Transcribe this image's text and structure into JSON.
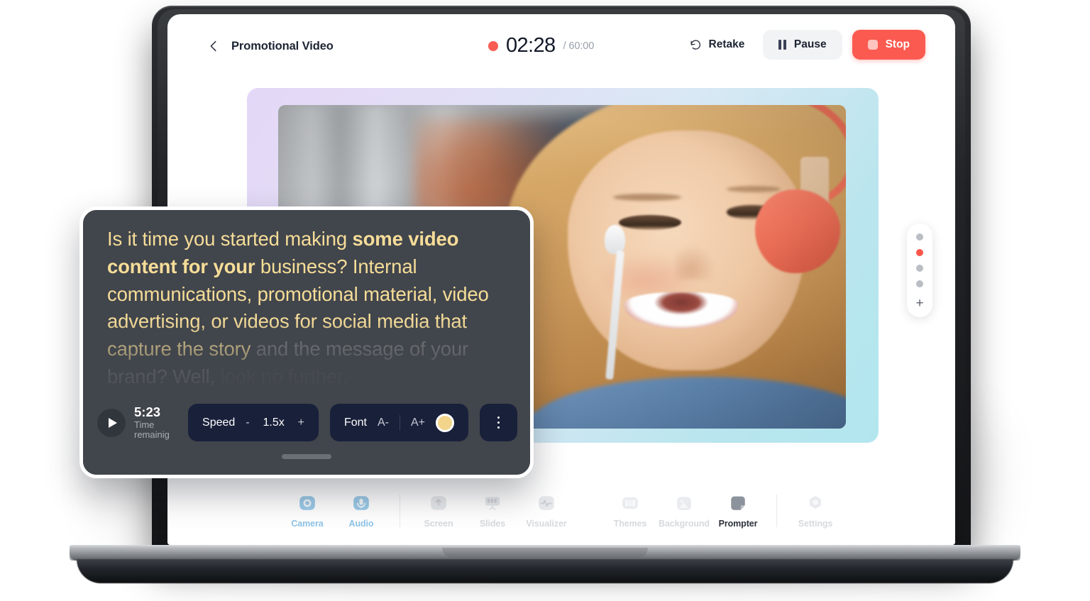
{
  "header": {
    "back_icon": "chevron-left-icon",
    "project_title": "Promotional Video",
    "record_dot": "record-dot-icon",
    "elapsed_time": "02:28",
    "total_time": "/ 60:00",
    "retake_label": "Retake",
    "retake_icon": "rotate-ccw-icon",
    "pause_label": "Pause",
    "pause_icon": "pause-icon",
    "stop_label": "Stop",
    "stop_icon": "stop-square-icon"
  },
  "colors": {
    "accent_red": "#fb5a50",
    "record_dot": "#fa5c52",
    "prompter_bg": "#41454c",
    "prompter_text": "#f6dd98",
    "control_bg": "#19203a",
    "swatch": "#f2d58a",
    "active_tool": "#8ec4e8",
    "frame_gradient_start": "#e4d7f7",
    "frame_gradient_end": "#b2e6ef"
  },
  "video": {
    "frame_label": "video-preview-frame"
  },
  "dot_rail": {
    "dots": [
      {
        "name": "scene-dot-1",
        "active": false
      },
      {
        "name": "scene-dot-2",
        "active": true
      },
      {
        "name": "scene-dot-3",
        "active": false
      },
      {
        "name": "scene-dot-4",
        "active": false
      }
    ],
    "add_label": "+"
  },
  "prompter": {
    "script_lines": [
      {
        "text": "Is it time you started making ",
        "style": "normal",
        "state": "read"
      },
      {
        "text": "some video content for your",
        "style": "bold",
        "state": "read"
      },
      {
        "text": " business? Internal communications, promotional material, video advertising, or videos for social media that capture the story",
        "style": "normal",
        "state": "read"
      },
      {
        "text": " and the message of your brand? Well,",
        "style": "normal",
        "state": "upcoming"
      },
      {
        "text": " look no further.",
        "style": "normal",
        "state": "upcoming-dim"
      }
    ],
    "script_full": "Is it time you started making some video content for your business? Internal communications, promotional material, video advertising, or videos for social media that capture the story and the message of your brand? Well, look no further.",
    "play_icon": "play-icon",
    "time_value": "5:23",
    "time_label": "Time remainig",
    "speed": {
      "label": "Speed",
      "minus": "-",
      "value": "1.5x",
      "plus": "+"
    },
    "font": {
      "label": "Font",
      "decrease": "A-",
      "increase": "A+",
      "color_swatch": "font-color-swatch"
    },
    "more_icon": "kebab-menu-icon",
    "drag_handle": "drag-handle"
  },
  "toolbar": {
    "items": [
      {
        "label": "Camera",
        "icon": "camera-icon",
        "state": "on"
      },
      {
        "label": "Audio",
        "icon": "microphone-icon",
        "state": "on"
      },
      {
        "label": "Screen",
        "icon": "screen-share-icon",
        "state": "off"
      },
      {
        "label": "Slides",
        "icon": "slides-icon",
        "state": "off"
      },
      {
        "label": "Visualizer",
        "icon": "waveform-icon",
        "state": "off"
      },
      {
        "label": "Themes",
        "icon": "themes-icon",
        "state": "dim"
      },
      {
        "label": "Background",
        "icon": "image-icon",
        "state": "dim"
      },
      {
        "label": "Prompter",
        "icon": "prompter-icon",
        "state": "sel"
      },
      {
        "label": "Settings",
        "icon": "gear-icon",
        "state": "dim"
      }
    ]
  }
}
